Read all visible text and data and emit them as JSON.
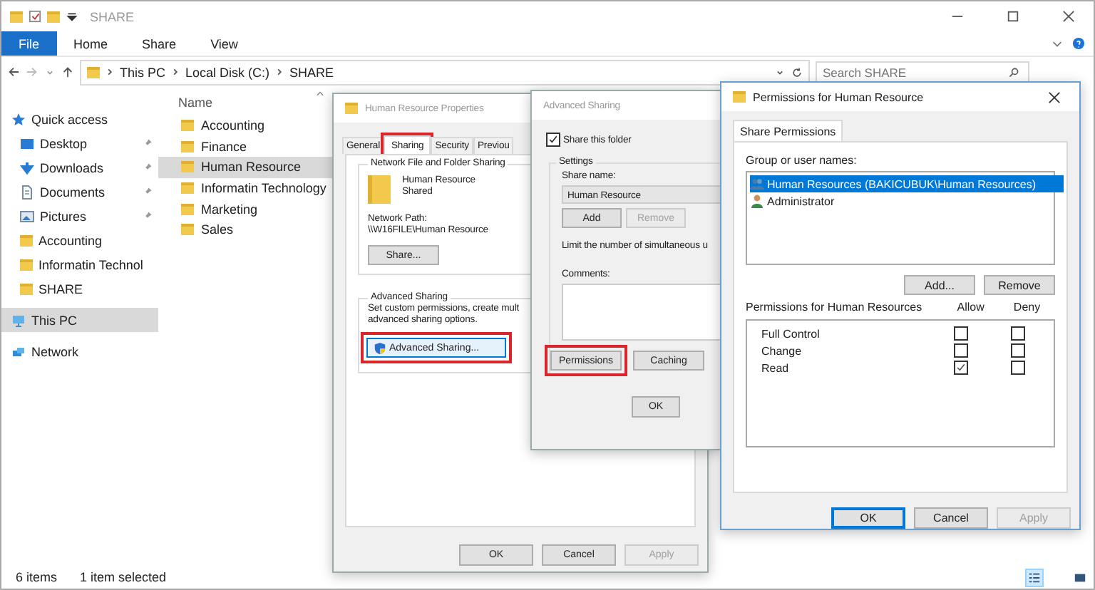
{
  "explorer": {
    "title": "SHARE",
    "ribbon_tabs": [
      {
        "label": "File",
        "selected": true
      },
      {
        "label": "Home",
        "selected": false
      },
      {
        "label": "Share",
        "selected": false
      },
      {
        "label": "View",
        "selected": false
      }
    ],
    "breadcrumb": [
      "This PC",
      "Local Disk (C:)",
      "SHARE"
    ],
    "search": {
      "placeholder": "Search SHARE"
    },
    "sidebar": [
      {
        "label": "Quick access",
        "selected": false,
        "children": [
          {
            "label": "Desktop",
            "pinned": true
          },
          {
            "label": "Downloads",
            "pinned": true
          },
          {
            "label": "Documents",
            "pinned": true
          },
          {
            "label": "Pictures",
            "pinned": true
          },
          {
            "label": "Accounting",
            "pinned": false
          },
          {
            "label": "Informatin Technol",
            "pinned": false
          },
          {
            "label": "SHARE",
            "pinned": false
          }
        ]
      },
      {
        "label": "This PC",
        "selected": true
      },
      {
        "label": "Network",
        "selected": false
      }
    ],
    "column_header": "Name",
    "files": [
      {
        "name": "Accounting",
        "selected": false
      },
      {
        "name": "Finance",
        "selected": false
      },
      {
        "name": "Human Resource",
        "selected": true
      },
      {
        "name": "Informatin Technology",
        "selected": false
      },
      {
        "name": "Marketing",
        "selected": false
      },
      {
        "name": "Sales",
        "selected": false
      }
    ],
    "status": [
      "6 items",
      "1 item selected"
    ]
  },
  "properties": {
    "title": "Human Resource Properties",
    "tabs": [
      {
        "label": "General",
        "selected": false,
        "highlighted": false
      },
      {
        "label": "Sharing",
        "selected": true,
        "highlighted": true
      },
      {
        "label": "Security",
        "selected": false,
        "highlighted": false
      },
      {
        "label": "Previou",
        "selected": false,
        "highlighted": false
      }
    ],
    "network_group": {
      "title": "Network File and Folder Sharing",
      "name": "Human Resource",
      "status": "Shared",
      "path_label": "Network Path:",
      "path": "\\\\W16FILE\\Human Resource",
      "button": "Share..."
    },
    "advanced_group": {
      "title": "Advanced Sharing",
      "lines": [
        "Set custom permissions, create mult",
        "advanced sharing options."
      ],
      "button": {
        "label": "Advanced Sharing...",
        "highlighted": true
      }
    },
    "buttons": [
      {
        "label": "OK",
        "disabled": false
      },
      {
        "label": "Cancel",
        "disabled": false
      },
      {
        "label": "Apply",
        "disabled": true
      }
    ]
  },
  "advanced": {
    "title": "Advanced Sharing",
    "share_folder": {
      "label": "Share this folder",
      "checked": true
    },
    "settings_title": "Settings",
    "share_name_label": "Share name:",
    "share_name": "Human Resource",
    "name_buttons": [
      {
        "label": "Add",
        "disabled": false
      },
      {
        "label": "Remove",
        "disabled": true
      }
    ],
    "limit_text": "Limit the number of simultaneous u",
    "comments_label": "Comments:",
    "buttons": [
      {
        "label": "Permissions",
        "highlighted": true
      },
      {
        "label": "Caching",
        "highlighted": false
      }
    ],
    "ok": "OK"
  },
  "permissions": {
    "title": "Permissions for Human Resource",
    "tab": "Share Permissions",
    "group_label": "Group or user names:",
    "users": [
      {
        "name": "Human Resources (BAKICUBUK\\Human Resources)",
        "selected": true
      },
      {
        "name": "Administrator",
        "selected": false
      }
    ],
    "user_buttons": [
      "Add...",
      "Remove"
    ],
    "perm_label": "Permissions for Human Resources",
    "columns": [
      "Allow",
      "Deny"
    ],
    "rows": [
      {
        "name": "Full Control",
        "allow": false,
        "deny": false
      },
      {
        "name": "Change",
        "allow": false,
        "deny": false
      },
      {
        "name": "Read",
        "allow": true,
        "deny": false
      }
    ],
    "buttons": [
      {
        "label": "OK",
        "default": true,
        "disabled": false
      },
      {
        "label": "Cancel",
        "default": false,
        "disabled": false
      },
      {
        "label": "Apply",
        "default": false,
        "disabled": true
      }
    ]
  }
}
